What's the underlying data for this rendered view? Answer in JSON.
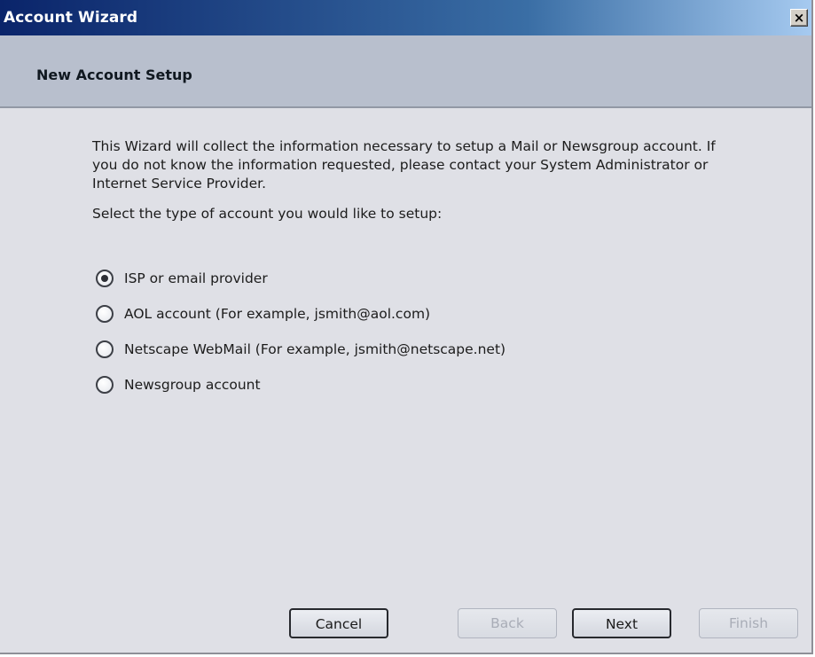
{
  "window": {
    "title": "Account Wizard",
    "close_glyph": "×"
  },
  "header": {
    "title": "New Account Setup"
  },
  "content": {
    "description": "This Wizard will collect the information necessary to setup a Mail or Newsgroup account. If you do not know the information requested, please contact your System Administrator or Internet Service Provider.",
    "prompt": "Select the type of account you would like to setup:",
    "options": [
      {
        "label": "ISP or email provider",
        "checked": true
      },
      {
        "label": "AOL account (For example, jsmith@aol.com)",
        "checked": false
      },
      {
        "label": "Netscape WebMail (For example, jsmith@netscape.net)",
        "checked": false
      },
      {
        "label": "Newsgroup account",
        "checked": false
      }
    ]
  },
  "buttons": {
    "cancel": {
      "label": "Cancel",
      "enabled": true
    },
    "back": {
      "label": "Back",
      "enabled": false
    },
    "next": {
      "label": "Next",
      "enabled": true
    },
    "finish": {
      "label": "Finish",
      "enabled": false
    }
  },
  "colors": {
    "title_bar_start": "#0a246a",
    "title_bar_end": "#a6caf0",
    "header_band": "#b8bfcd",
    "dialog_background": "#dfe0e6"
  }
}
